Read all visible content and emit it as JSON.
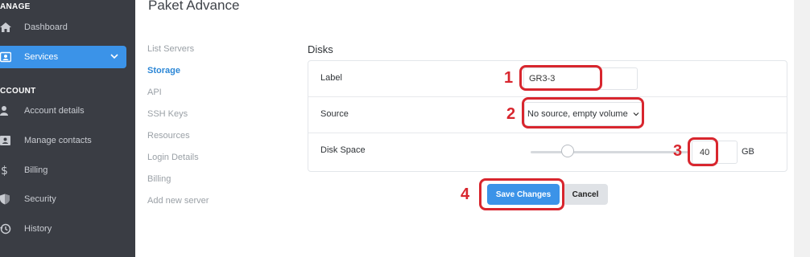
{
  "sidebar": {
    "manage_label": "ANAGE",
    "account_label": "CCOUNT",
    "items": [
      {
        "label": "Dashboard",
        "icon": "home-icon"
      },
      {
        "label": "Services",
        "icon": "id-card-icon",
        "active": true
      },
      {
        "label": "Account details",
        "icon": "user-icon"
      },
      {
        "label": "Manage contacts",
        "icon": "contacts-icon"
      },
      {
        "label": "Billing",
        "icon": "dollar-icon"
      },
      {
        "label": "Security",
        "icon": "shield-icon"
      },
      {
        "label": "History",
        "icon": "history-icon"
      }
    ]
  },
  "page": {
    "title": "Paket Advance"
  },
  "subnav": {
    "items": [
      "List Servers",
      "Storage",
      "API",
      "SSH Keys",
      "Resources",
      "Login Details",
      "Billing",
      "Add new server"
    ],
    "active": "Storage"
  },
  "disks": {
    "section_title": "Disks",
    "label_field": {
      "label": "Label",
      "value": "GR3-3"
    },
    "source_field": {
      "label": "Source",
      "value": "No source, empty volume"
    },
    "disk_space_field": {
      "label": "Disk Space",
      "value": "40",
      "unit": "GB",
      "slider_fraction": 0.23
    }
  },
  "actions": {
    "save_label": "Save Changes",
    "cancel_label": "Cancel"
  },
  "annotations": [
    "1",
    "2",
    "3",
    "4"
  ],
  "colors": {
    "sidebar_bg": "#3a3d44",
    "accent": "#3b93e8",
    "annotation": "#d8262e"
  }
}
